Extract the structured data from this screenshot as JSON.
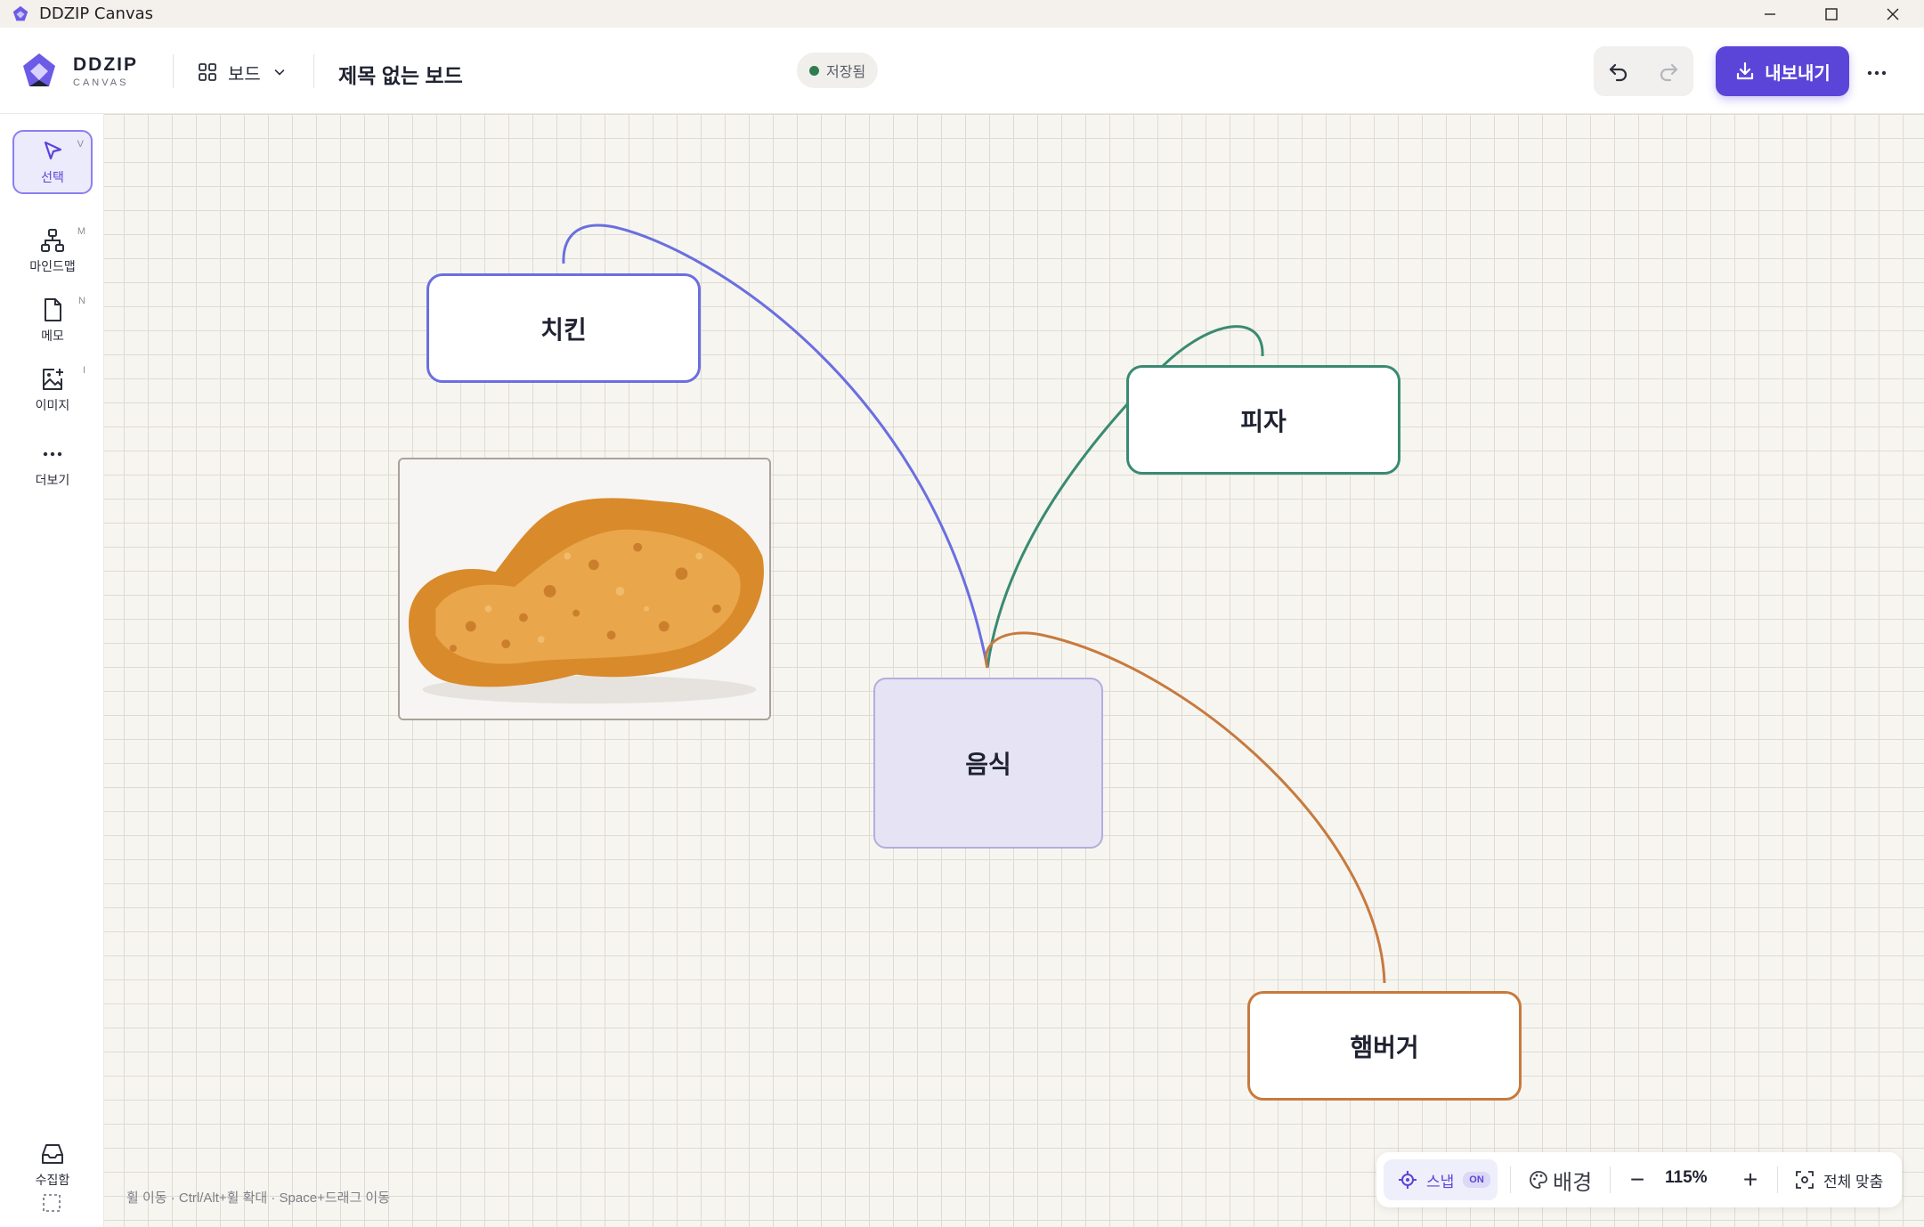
{
  "window": {
    "title": "DDZIP Canvas"
  },
  "header": {
    "brand_name": "DDZIP",
    "brand_sub": "CANVAS",
    "board_menu_label": "보드",
    "board_title": "제목 없는 보드",
    "saved_status": "저장됨",
    "export_label": "내보내기"
  },
  "sidebar": {
    "tools": [
      {
        "label": "선택",
        "key": "V",
        "icon": "cursor-icon"
      },
      {
        "label": "마인드맵",
        "key": "M",
        "icon": "mindmap-icon"
      },
      {
        "label": "메모",
        "key": "N",
        "icon": "note-icon"
      },
      {
        "label": "이미지",
        "key": "I",
        "icon": "image-add-icon"
      },
      {
        "label": "더보기",
        "key": "",
        "icon": "more-icon"
      }
    ],
    "inbox_label": "수집함"
  },
  "canvas": {
    "nodes": {
      "chicken": "치킨",
      "pizza": "피자",
      "food": "음식",
      "burger": "햄버거"
    },
    "edge_colors": {
      "chicken": "#6a6fe0",
      "pizza": "#3a8a72",
      "burger": "#c77a3e"
    },
    "hint": "휠 이동 · Ctrl/Alt+휠 확대 · Space+드래그 이동"
  },
  "bottom_bar": {
    "snap_label": "스냅",
    "snap_state": "ON",
    "background_label": "배경",
    "zoom_minus": "−",
    "zoom_value": "115%",
    "zoom_plus": "+",
    "fit_label": "전체 맞춤"
  },
  "colors": {
    "accent": "#5b45d9",
    "root_node_fill": "#e6e3f5"
  }
}
